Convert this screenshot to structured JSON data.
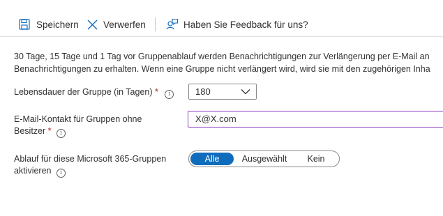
{
  "toolbar": {
    "save_label": "Speichern",
    "discard_label": "Verwerfen",
    "feedback_label": "Haben Sie Feedback für uns?"
  },
  "description": {
    "line1": "30 Tage, 15 Tage und 1 Tag vor Gruppenablauf werden Benachrichtigungen zur Verlängerung per E-Mail an",
    "line2": "Benachrichtigungen zu erhalten. Wenn eine Gruppe nicht verlängert wird, wird sie mit den zugehörigen Inha"
  },
  "lifetime": {
    "label": "Lebensdauer der Gruppe (in Tagen)",
    "required": "*",
    "value": "180"
  },
  "email": {
    "label_line1": "E-Mail-Kontakt für Gruppen ohne",
    "label_line2": "Besitzer",
    "required": "*",
    "value": "X@X.com"
  },
  "expiration": {
    "label_line1": "Ablauf für diese Microsoft 365-Gruppen",
    "label_line2": "aktivieren",
    "options": [
      "Alle",
      "Ausgewählt",
      "Kein"
    ],
    "selected": "Alle"
  },
  "colors": {
    "accent": "#0f6cbd",
    "required": "#a4262c",
    "focus_border": "#8a3dc4"
  },
  "icons": [
    "save-icon",
    "close-icon",
    "feedback-icon",
    "info-icon",
    "chevron-down-icon"
  ]
}
